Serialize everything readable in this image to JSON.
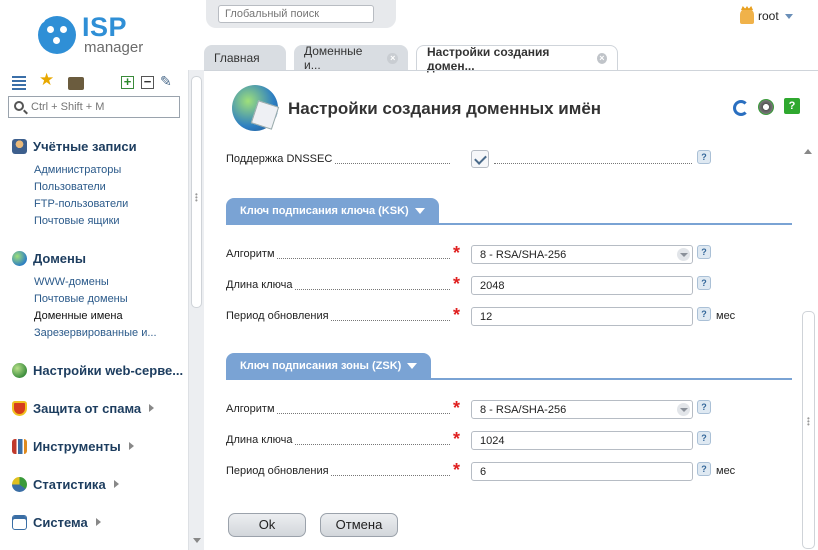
{
  "brand": {
    "line1": "ISP",
    "line2": "manager"
  },
  "search": {
    "placeholder": "Глобальный поиск"
  },
  "user": {
    "name": "root"
  },
  "tabs": [
    {
      "label": "Главная"
    },
    {
      "label": "Доменные и..."
    },
    {
      "label": "Настройки создания домен..."
    }
  ],
  "sidebar": {
    "search_placeholder": "Ctrl + Shift + M",
    "groups": [
      {
        "title": "Учётные записи",
        "items": [
          "Администраторы",
          "Пользователи",
          "FTP-пользователи",
          "Почтовые ящики"
        ]
      },
      {
        "title": "Домены",
        "items": [
          "WWW-домены",
          "Почтовые домены",
          "Доменные имена",
          "Зарезервированные и..."
        ],
        "selected": "Доменные имена"
      },
      {
        "title": "Настройки web-серве..."
      },
      {
        "title": "Защита от спама"
      },
      {
        "title": "Инструменты"
      },
      {
        "title": "Статистика"
      },
      {
        "title": "Система"
      }
    ]
  },
  "form": {
    "title": "Настройки создания доменных имён",
    "dnssec_label": "Поддержка DNSSEC",
    "dnssec_checked": true,
    "ksk": {
      "section": "Ключ подписания ключа (KSK)",
      "algorithm_label": "Алгоритм",
      "algorithm_value": "8 - RSA/SHA-256",
      "keylen_label": "Длина ключа",
      "keylen_value": "2048",
      "period_label": "Период обновления",
      "period_value": "12",
      "period_unit": "мес"
    },
    "zsk": {
      "section": "Ключ подписания зоны (ZSK)",
      "algorithm_label": "Алгоритм",
      "algorithm_value": "8 - RSA/SHA-256",
      "keylen_label": "Длина ключа",
      "keylen_value": "1024",
      "period_label": "Период обновления",
      "period_value": "6",
      "period_unit": "мес"
    },
    "help": "?",
    "ok": "Ok",
    "cancel": "Отмена"
  },
  "colors": {
    "accent": "#2f8fd6",
    "section": "#7aa3d4",
    "required": "#e02020"
  }
}
